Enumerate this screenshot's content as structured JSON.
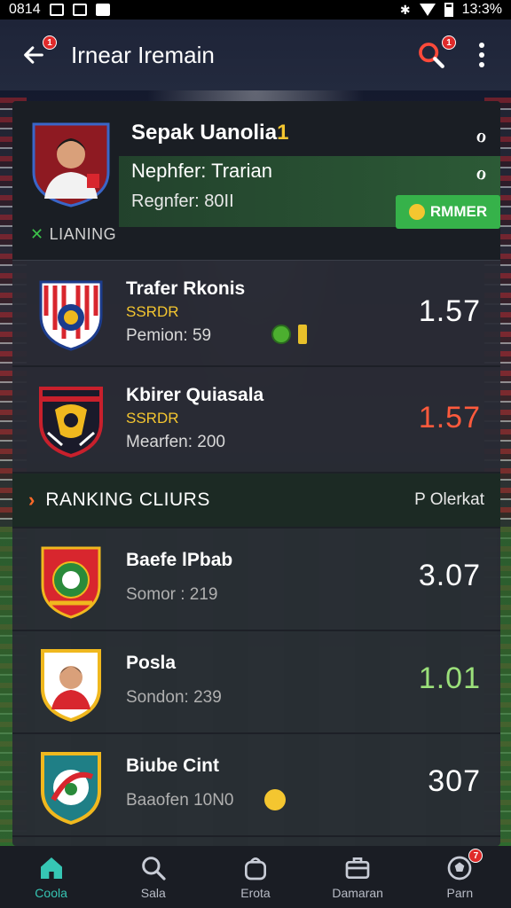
{
  "status_bar": {
    "time_left": "0814",
    "time_right": "13:3%"
  },
  "app_bar": {
    "title": "Irnear Iremain",
    "back_badge": "1",
    "search_badge": "1"
  },
  "featured": {
    "name": "Sepak Uanolia",
    "name_suffix": "1",
    "subtitle": "Nephfer: Trarian",
    "detail": "Regnfer: 80II",
    "button_label": "RMMER",
    "ranking_tag": "LIANING",
    "icon_a": "ℴ",
    "icon_b": "ℴ"
  },
  "transfers": [
    {
      "title": "Trafer Rkonis",
      "tag": "SSRDR",
      "meta": "Pemion: 59",
      "score": "1.57",
      "score_color": "#ffffff",
      "crest_colors": [
        "#d8262e",
        "#ffffff",
        "#1c3c8c"
      ]
    },
    {
      "title": "Kbirer Quiasala",
      "tag": "SSRDR",
      "meta": "Mearfen: 200",
      "score": "1.57",
      "score_color": "#ff5a3c",
      "crest_colors": [
        "#c8202c",
        "#1a1a2a",
        "#f0b81e"
      ]
    }
  ],
  "section": {
    "label": "RANKING CLIURS",
    "right_label": "P Olerkat"
  },
  "clubs": [
    {
      "title": "Baefe lPbab",
      "meta": "Somor : 219",
      "score": "3.07",
      "score_color": "#ffffff",
      "crest": "red-green"
    },
    {
      "title": "Posla",
      "meta": "Sondon: 239",
      "score": "1.01",
      "score_color": "#9be07a",
      "crest": "player"
    },
    {
      "title": "Biube Cint",
      "meta": "Baaofen 10N0",
      "score": "307",
      "score_color": "#ffffff",
      "crest": "teal-red"
    }
  ],
  "bottom_nav": [
    {
      "label": "Coola",
      "icon": "home-icon",
      "active": true
    },
    {
      "label": "Sala",
      "icon": "search-icon",
      "active": false
    },
    {
      "label": "Erota",
      "icon": "bag-icon",
      "active": false
    },
    {
      "label": "Damaran",
      "icon": "briefcase-icon",
      "active": false
    },
    {
      "label": "Parn",
      "icon": "ball-icon",
      "active": false,
      "badge": "7"
    }
  ],
  "colors": {
    "accent_green": "#36b24a",
    "accent_yellow": "#f4c630",
    "accent_red": "#ff5a3c",
    "accent_teal": "#36c6b4"
  }
}
